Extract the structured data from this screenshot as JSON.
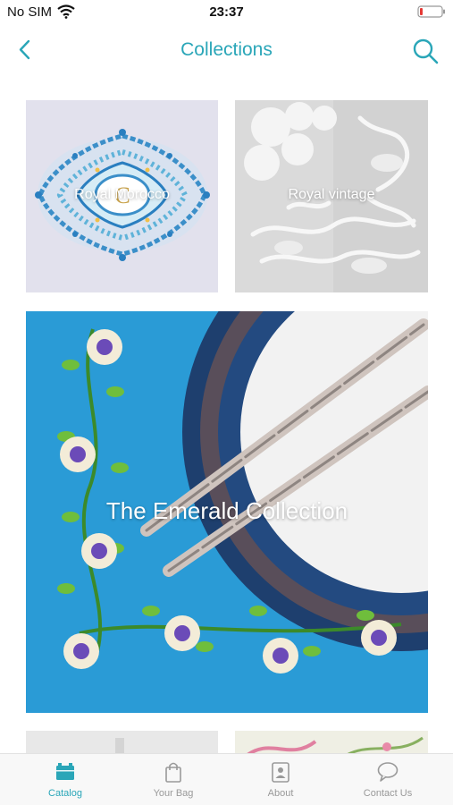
{
  "status_bar": {
    "carrier": "No SIM",
    "time": "23:37",
    "battery_color": "#e53935"
  },
  "nav": {
    "title": "Collections",
    "accent_color": "#2aa6b8",
    "left_icon": "chevron-left-icon",
    "right_icon": "search-icon"
  },
  "collections": [
    {
      "label": "Royal Morocco"
    },
    {
      "label": "Royal vintage"
    },
    {
      "label": "The Emerald Collection"
    }
  ],
  "tabs": [
    {
      "label": "Catalog",
      "icon": "catalog-icon",
      "active": true
    },
    {
      "label": "Your Bag",
      "icon": "bag-icon",
      "active": false
    },
    {
      "label": "About",
      "icon": "about-icon",
      "active": false
    },
    {
      "label": "Contact Us",
      "icon": "chat-icon",
      "active": false
    }
  ]
}
